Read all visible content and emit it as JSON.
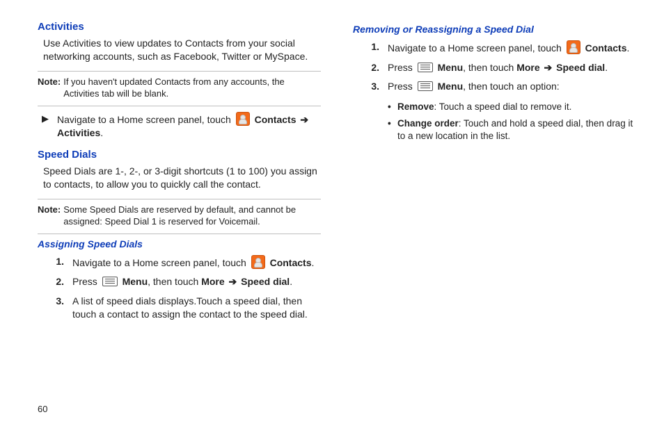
{
  "page_number": "60",
  "left": {
    "activities": {
      "heading": "Activities",
      "body": "Use Activities to view updates to Contacts from your social networking accounts, such as Facebook, Twitter or MySpace.",
      "note_label": "Note:",
      "note_text": "If you haven't updated Contacts from any accounts, the Activities tab will be blank.",
      "action": {
        "pre": "Navigate to a Home screen panel, touch ",
        "bold1": "Contacts",
        "bold2": "Activities",
        "period": "."
      }
    },
    "speeddials": {
      "heading": "Speed Dials",
      "body": "Speed Dials are 1-, 2-, or 3-digit shortcuts (1 to 100) you assign to contacts, to allow you to quickly call the contact.",
      "note_label": "Note:",
      "note_text": "Some Speed Dials are reserved by default, and cannot be assigned: Speed Dial 1 is reserved for Voicemail."
    },
    "assign": {
      "heading": "Assigning Speed Dials",
      "step1": {
        "pre": "Navigate to a Home screen panel, touch ",
        "bold": "Contacts",
        "period": "."
      },
      "step2": {
        "press": "Press ",
        "menu": "Menu",
        "mid": ", then touch ",
        "more": "More",
        "speed": "Speed dial",
        "period": "."
      },
      "step3": "A list of speed dials displays.Touch a speed dial, then touch a contact to assign the contact to the speed dial."
    }
  },
  "right": {
    "heading": "Removing or Reassigning a Speed Dial",
    "step1": {
      "pre": "Navigate to a Home screen panel, touch ",
      "bold": "Contacts",
      "period": "."
    },
    "step2": {
      "press": "Press ",
      "menu": "Menu",
      "mid": ", then touch ",
      "more": "More",
      "speed": "Speed dial",
      "period": "."
    },
    "step3": {
      "press": "Press ",
      "menu": "Menu",
      "tail": ", then touch an option:"
    },
    "bullets": {
      "b1_label": "Remove",
      "b1_text": ": Touch a speed dial to remove it.",
      "b2_label": "Change order",
      "b2_text": ": Touch and hold a speed dial, then drag it to a new location in the list."
    }
  }
}
